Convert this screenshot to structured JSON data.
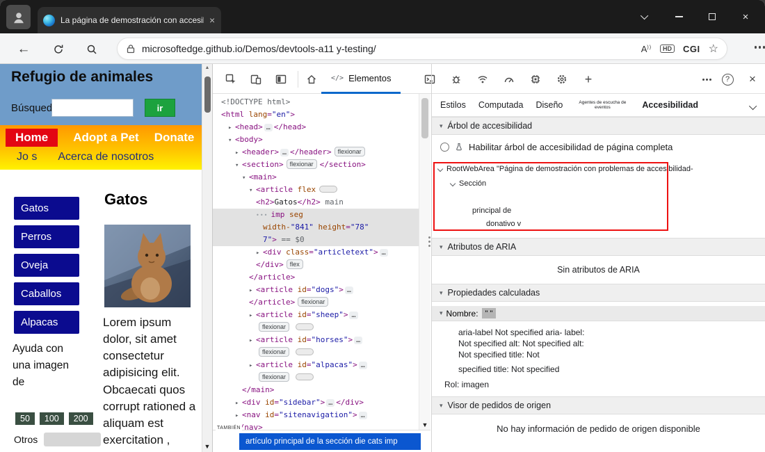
{
  "colors": {
    "accent_blue": "#0b57d0",
    "highlight_red": "#ee1111",
    "page_header_blue": "#6f9cc9",
    "nav_orange": "#ff9800",
    "home_red": "#e30613",
    "button_navy": "#0b0b8f",
    "go_green": "#1ca23e",
    "tag": "#881280",
    "attr": "#994500",
    "value": "#1a1aa6"
  },
  "icons": {
    "triangle_down": "▾",
    "triangle_closed": "▸",
    "arrow_up": "▲",
    "arrow_down": "▼",
    "ellipsis": "…",
    "gutter_dots": "•••",
    "star": "☆",
    "back": "←",
    "close": "×",
    "plus": "+",
    "help": "?",
    "code": "</>"
  },
  "titlebar": {
    "tab_title": "La página de demostración con accesibilidad es"
  },
  "addressbar": {
    "url": "microsoftedge.github.io/Demos/devtools-a11 y-testing/",
    "read_aloud": "A",
    "hd_badge": "HD",
    "cgi_label": "CGI"
  },
  "page": {
    "title": "Refugio de animales",
    "search_label": "Búsqueda",
    "go_button": "ir",
    "nav_items": [
      "Home",
      "Adopt a Pet",
      "Donate"
    ],
    "nav_items2": [
      "Jo s",
      "Acerca de nosotros"
    ],
    "sidebar_buttons": [
      "Gatos",
      "Perros",
      "Oveja",
      "Caballos",
      "Alpacas"
    ],
    "help_text": "Ayuda con una imagen de",
    "stat_badges": [
      "50",
      "100",
      "200"
    ],
    "others_label": "Otros",
    "section_heading": "Gatos",
    "lorem": "Lorem ipsum dolor, sit amet consectetur adipisicing elit. Obcaecati quos corrupt rationed a aliquam est exercitation ,"
  },
  "devtools": {
    "toolbar": {
      "elements_label": "Elementos"
    },
    "dom_tree": [
      {
        "ind": 0,
        "tok": [
          {
            "c": "gray",
            "t": "<!DOCTYPE html>"
          }
        ]
      },
      {
        "ind": 0,
        "tok": [
          {
            "c": "tag",
            "t": "<html "
          },
          {
            "c": "attr",
            "t": "lang"
          },
          {
            "c": "tag",
            "t": "="
          },
          {
            "c": "val",
            "t": "\"en\""
          },
          {
            "c": "tag",
            "t": ">"
          }
        ]
      },
      {
        "ind": 1,
        "caret": "c",
        "tok": [
          {
            "c": "tag",
            "t": "<head>"
          },
          {
            "c": "dots",
            "t": "…"
          },
          {
            "c": "tag",
            "t": "</head>"
          }
        ]
      },
      {
        "ind": 1,
        "caret": "o",
        "tok": [
          {
            "c": "tag",
            "t": "<body>"
          }
        ]
      },
      {
        "ind": 2,
        "caret": "c",
        "tok": [
          {
            "c": "tag",
            "t": "<header>"
          },
          {
            "c": "dots",
            "t": "…"
          },
          {
            "c": "tag",
            "t": "</header>"
          },
          {
            "c": "badge",
            "t": "flexionar"
          }
        ]
      },
      {
        "ind": 2,
        "caret": "o",
        "tok": [
          {
            "c": "tag",
            "t": "<section>"
          },
          {
            "c": "badge",
            "t": "flexionar"
          },
          {
            "c": "tag",
            "t": "</section>"
          }
        ]
      },
      {
        "ind": 3,
        "caret": "o",
        "tok": [
          {
            "c": "tag",
            "t": "<main>"
          }
        ]
      },
      {
        "ind": 4,
        "caret": "o",
        "tok": [
          {
            "c": "tag",
            "t": "<article "
          },
          {
            "c": "attr",
            "t": "flex"
          },
          {
            "c": "pill",
            "t": ""
          }
        ]
      },
      {
        "ind": 5,
        "tok": [
          {
            "c": "tag",
            "t": "<h2>"
          },
          {
            "c": "txt",
            "t": "Gatos"
          },
          {
            "c": "tag",
            "t": "</h2>"
          },
          {
            "c": "gray",
            "t": " main"
          }
        ]
      },
      {
        "ind": 5,
        "sel": true,
        "tok": [
          {
            "c": "gut",
            "t": "•••"
          },
          {
            "c": "tag",
            "t": "imp "
          },
          {
            "c": "attr",
            "t": "seg"
          }
        ]
      },
      {
        "ind": 6,
        "sel": true,
        "tok": [
          {
            "c": "attr",
            "t": "width-"
          },
          {
            "c": "val",
            "t": "\"841\""
          },
          {
            "c": "attr",
            "t": " height"
          },
          {
            "c": "tag",
            "t": "="
          },
          {
            "c": "val",
            "t": "\"78\""
          }
        ]
      },
      {
        "ind": 6,
        "sel": true,
        "tok": [
          {
            "c": "val",
            "t": "7\""
          },
          {
            "c": "tag",
            "t": ">"
          },
          {
            "c": "gray",
            "t": " == $0"
          }
        ]
      },
      {
        "ind": 5,
        "caret": "c",
        "tok": [
          {
            "c": "tag",
            "t": "<div "
          },
          {
            "c": "attr",
            "t": "class"
          },
          {
            "c": "tag",
            "t": "="
          },
          {
            "c": "val",
            "t": "\"articletext\""
          },
          {
            "c": "tag",
            "t": ">"
          },
          {
            "c": "dots",
            "t": "…"
          }
        ]
      },
      {
        "ind": 5,
        "tok": [
          {
            "c": "tag",
            "t": "</div>"
          },
          {
            "c": "badge",
            "t": "flex"
          }
        ]
      },
      {
        "ind": 4,
        "tok": [
          {
            "c": "tag",
            "t": "</article>"
          }
        ]
      },
      {
        "ind": 4,
        "caret": "c",
        "tok": [
          {
            "c": "tag",
            "t": "<article "
          },
          {
            "c": "attr",
            "t": "id"
          },
          {
            "c": "tag",
            "t": "="
          },
          {
            "c": "val",
            "t": "\"dogs\""
          },
          {
            "c": "tag",
            "t": ">"
          },
          {
            "c": "dots",
            "t": "…"
          }
        ]
      },
      {
        "ind": 4,
        "tok": [
          {
            "c": "tag",
            "t": "</article>"
          },
          {
            "c": "badge",
            "t": "flexionar"
          }
        ]
      },
      {
        "ind": 4,
        "caret": "c",
        "tok": [
          {
            "c": "tag",
            "t": "<article "
          },
          {
            "c": "attr",
            "t": "id"
          },
          {
            "c": "tag",
            "t": "="
          },
          {
            "c": "val",
            "t": "\"sheep\""
          },
          {
            "c": "tag",
            "t": ">"
          },
          {
            "c": "dots",
            "t": "…"
          }
        ]
      },
      {
        "ind": 5,
        "tok": [
          {
            "c": "badge",
            "t": "flexionar"
          },
          {
            "c": "pill",
            "t": ""
          }
        ]
      },
      {
        "ind": 4,
        "caret": "c",
        "tok": [
          {
            "c": "tag",
            "t": "<article "
          },
          {
            "c": "attr",
            "t": "id"
          },
          {
            "c": "tag",
            "t": "="
          },
          {
            "c": "val",
            "t": "\"horses\""
          },
          {
            "c": "tag",
            "t": ">"
          },
          {
            "c": "dots",
            "t": "…"
          }
        ]
      },
      {
        "ind": 5,
        "tok": [
          {
            "c": "badge",
            "t": "flexionar"
          },
          {
            "c": "pill",
            "t": ""
          }
        ]
      },
      {
        "ind": 4,
        "caret": "c",
        "tok": [
          {
            "c": "tag",
            "t": "<article "
          },
          {
            "c": "attr",
            "t": "id"
          },
          {
            "c": "tag",
            "t": "="
          },
          {
            "c": "val",
            "t": "\"alpacas\""
          },
          {
            "c": "tag",
            "t": ">"
          },
          {
            "c": "dots",
            "t": "…"
          }
        ]
      },
      {
        "ind": 5,
        "tok": [
          {
            "c": "badge",
            "t": "flexionar"
          },
          {
            "c": "pill",
            "t": ""
          }
        ]
      },
      {
        "ind": 3,
        "tok": [
          {
            "c": "tag",
            "t": "</main>"
          }
        ]
      },
      {
        "ind": 2,
        "caret": "c",
        "tok": [
          {
            "c": "tag",
            "t": "<div "
          },
          {
            "c": "attr",
            "t": "id"
          },
          {
            "c": "tag",
            "t": "="
          },
          {
            "c": "val",
            "t": "\"sidebar\""
          },
          {
            "c": "tag",
            "t": ">"
          },
          {
            "c": "dots",
            "t": "…"
          },
          {
            "c": "tag",
            "t": "</div>"
          }
        ]
      },
      {
        "ind": 2,
        "caret": "c",
        "tok": [
          {
            "c": "tag",
            "t": "<nav "
          },
          {
            "c": "attr",
            "t": "id"
          },
          {
            "c": "tag",
            "t": "="
          },
          {
            "c": "val",
            "t": "\"sitenavigation\""
          },
          {
            "c": "tag",
            "t": ">"
          },
          {
            "c": "dots",
            "t": "…"
          }
        ]
      },
      {
        "ind": 2,
        "tok": [
          {
            "c": "tag",
            "t": "</nav>"
          }
        ]
      }
    ],
    "statusbar": {
      "tambien": "TAMBIÉN",
      "breadcrumb": "artículo principal de la sección die cats imp"
    },
    "right_tabs": [
      "Estilos",
      "Computada",
      "Diseño",
      "Agentes de escucha de eventos",
      "Accesibilidad"
    ],
    "right_tabs_selected": "Accesibilidad",
    "a11y": {
      "tree_header": "Árbol de accesibilidad",
      "enable_label": "Habilitar árbol de accesibilidad de página completa",
      "tree_rows": [
        "RootWebArea \"Página de demostración con problemas de accesibilidad-",
        "Sección",
        "principal de",
        "donativo v"
      ],
      "aria_header": "Atributos de ARIA",
      "aria_empty": "Sin atributos de ARIA",
      "computed_header": "Propiedades calculadas",
      "name_label": "Nombre:",
      "name_value": "\" \"",
      "prop_lines": [
        "aria-label Not specified aria- label:",
        "Not specified alt: Not specified alt:",
        "Not specified title: Not",
        "specified title: Not specified"
      ],
      "role_line": "Rol: imagen",
      "source_header": "Visor de pedidos de origen",
      "source_empty": "No hay información de pedido de origen disponible"
    }
  }
}
